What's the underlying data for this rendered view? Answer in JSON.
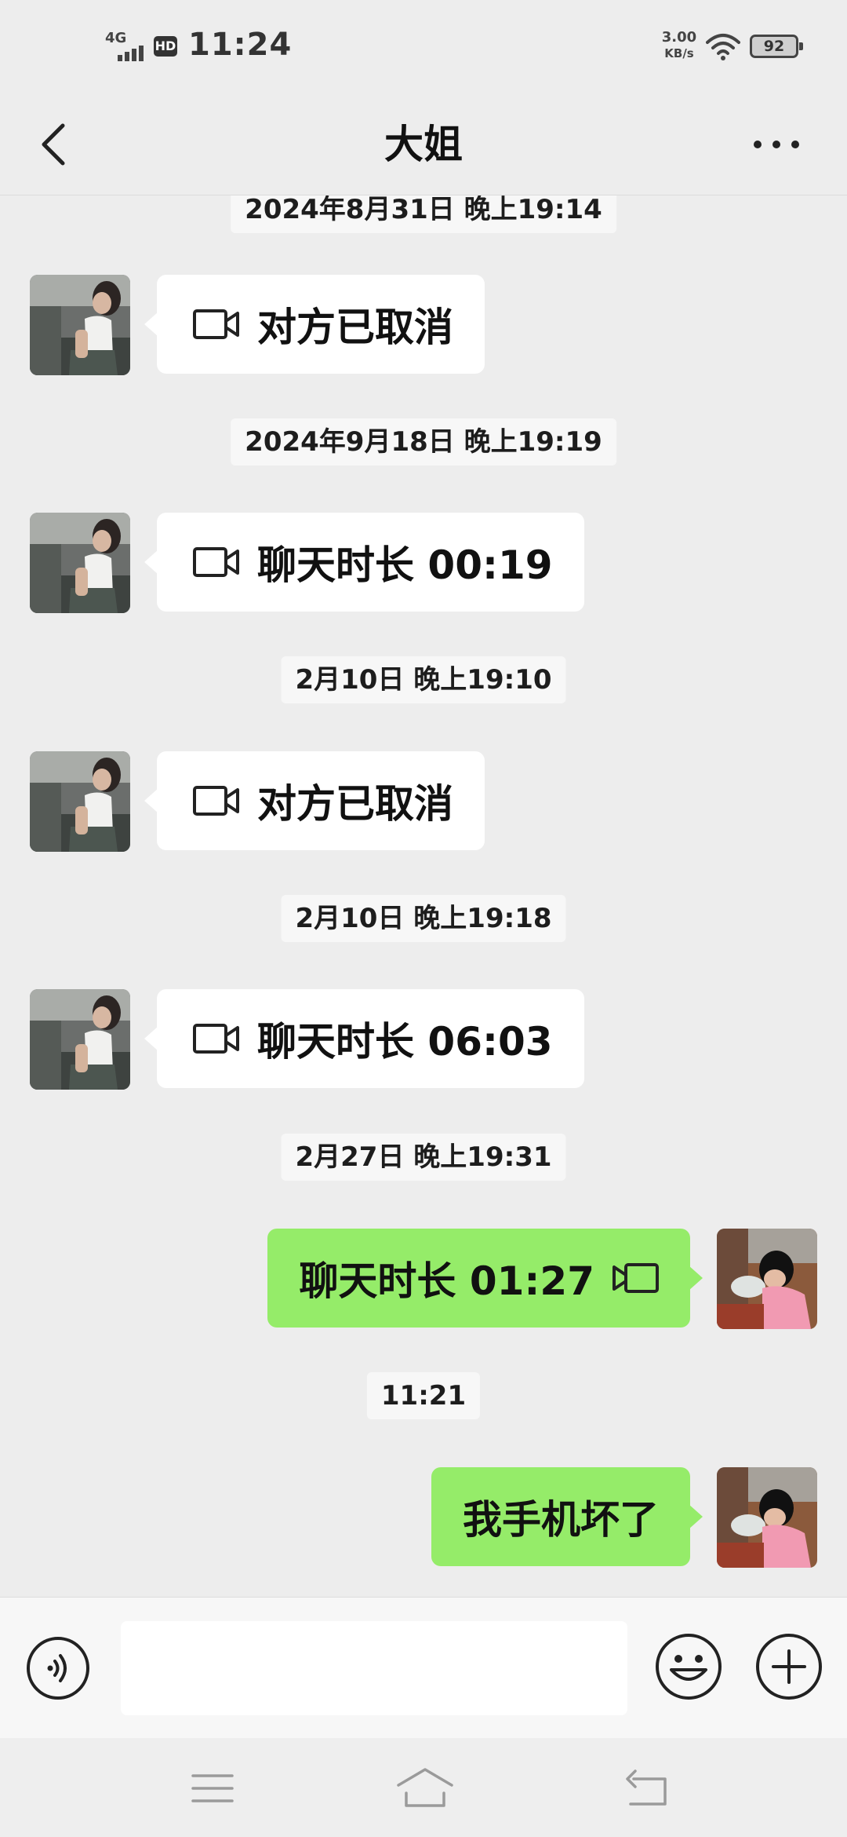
{
  "status_bar": {
    "network": "4G",
    "hd": "HD",
    "time": "11:24",
    "speed_value": "3.00",
    "speed_unit": "KB/s",
    "battery": "92"
  },
  "header": {
    "title": "大姐",
    "back_icon": "chevron-left-icon",
    "more_icon": "more-dots-icon"
  },
  "messages": [
    {
      "timestamp": "2024年8月31日 晚上19:14"
    },
    {
      "side": "left",
      "text": "对方已取消",
      "icon": "video-call-icon"
    },
    {
      "timestamp": "2024年9月18日 晚上19:19"
    },
    {
      "side": "left",
      "text": "聊天时长 00:19",
      "icon": "video-call-icon"
    },
    {
      "timestamp": "2月10日 晚上19:10"
    },
    {
      "side": "left",
      "text": "对方已取消",
      "icon": "video-call-icon"
    },
    {
      "timestamp": "2月10日 晚上19:18"
    },
    {
      "side": "left",
      "text": "聊天时长 06:03",
      "icon": "video-call-icon"
    },
    {
      "timestamp": "2月27日 晚上19:31"
    },
    {
      "side": "right",
      "text": "聊天时长 01:27",
      "icon": "video-call-icon"
    },
    {
      "timestamp": "11:21"
    },
    {
      "side": "right",
      "text": "我手机坏了"
    }
  ],
  "input_bar": {
    "voice_icon": "voice-input-icon",
    "placeholder": "",
    "emoji_icon": "emoji-icon",
    "plus_icon": "plus-icon"
  },
  "nav_bar": {
    "icons": [
      "menu-icon",
      "home-icon",
      "back-icon"
    ]
  },
  "colors": {
    "background": "#ededed",
    "sent_bubble": "#95ec69",
    "received_bubble": "#ffffff"
  }
}
